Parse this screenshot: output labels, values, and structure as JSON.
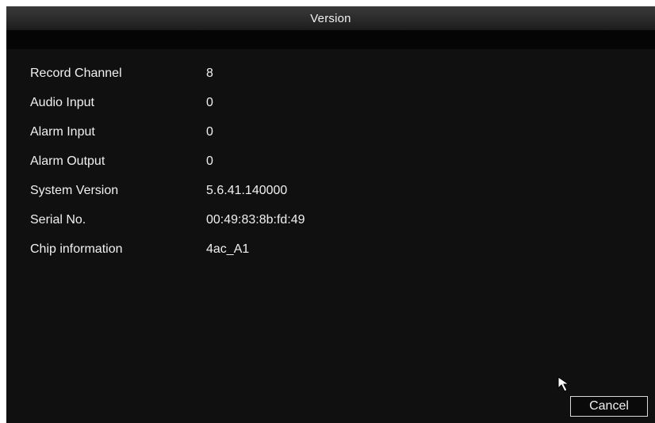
{
  "window": {
    "title": "Version"
  },
  "info": [
    {
      "label": "Record Channel",
      "value": "8"
    },
    {
      "label": "Audio Input",
      "value": "0"
    },
    {
      "label": "Alarm Input",
      "value": "0"
    },
    {
      "label": "Alarm Output",
      "value": "0"
    },
    {
      "label": "System Version",
      "value": "5.6.41.140000"
    },
    {
      "label": "Serial No.",
      "value": "00:49:83:8b:fd:49"
    },
    {
      "label": "Chip information",
      "value": "4ac_A1"
    }
  ],
  "actions": {
    "cancel_label": "Cancel"
  },
  "icons": {
    "cursor": "mouse-pointer-icon"
  },
  "colors": {
    "background": "#101010",
    "text": "#f0f0f0",
    "titlebar": "#2a2a2a"
  }
}
